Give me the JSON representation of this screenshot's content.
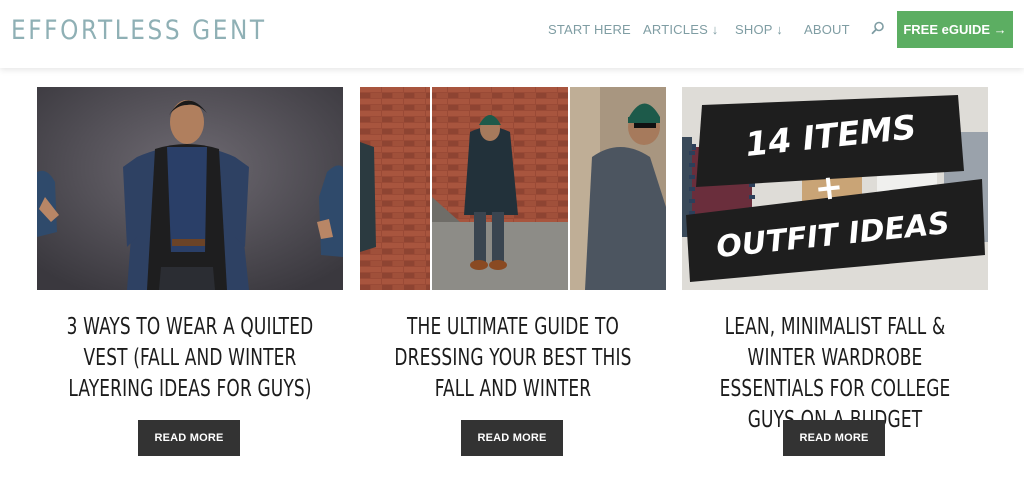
{
  "brand": {
    "logo": "EFFORTLESS GENT"
  },
  "nav": {
    "items": [
      {
        "label": "START HERE"
      },
      {
        "label": "ARTICLES ↓"
      },
      {
        "label": "SHOP ↓"
      },
      {
        "label": "ABOUT"
      }
    ],
    "cta_label": "FREE eGUIDE →"
  },
  "colors": {
    "brand": "#8fb0b5",
    "nav_text": "#7f9da3",
    "cta_bg": "#5cae62",
    "button_bg": "#333333"
  },
  "posts": [
    {
      "title": "3 WAYS TO WEAR A QUILTED VEST (FALL AND WINTER LAYERING IDEAS FOR GUYS)",
      "button_label": "READ MORE"
    },
    {
      "title": "THE ULTIMATE GUIDE TO DRESSING YOUR BEST THIS FALL AND WINTER",
      "button_label": "READ MORE"
    },
    {
      "title": "LEAN, MINIMALIST FALL & WINTER WARDROBE ESSENTIALS FOR COLLEGE GUYS ON A BUDGET",
      "button_label": "READ MORE",
      "image_text": [
        "14 ITEMS",
        "+",
        "OUTFIT IDEAS"
      ]
    }
  ]
}
